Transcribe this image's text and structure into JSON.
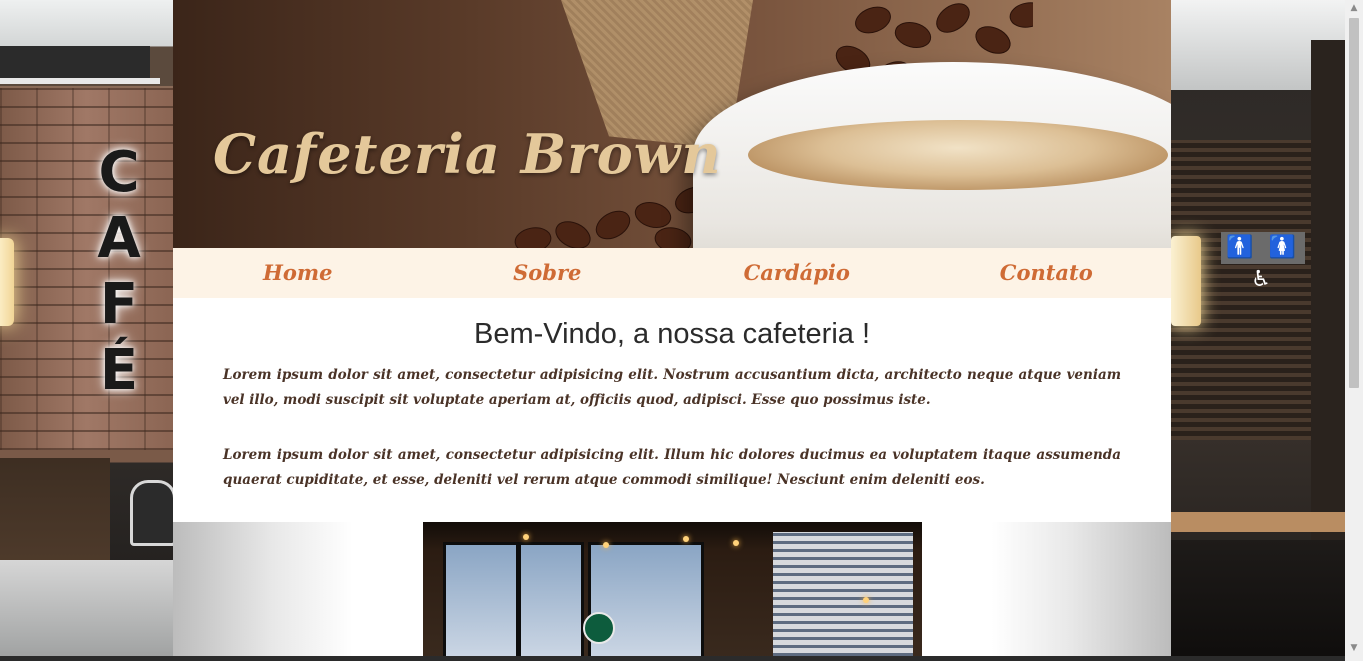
{
  "background": {
    "left_sign_letters": [
      "C",
      "A",
      "F",
      "É"
    ],
    "right_sign_icons": "🚹 🚺 ♿"
  },
  "hero": {
    "title": "Cafeteria Brown"
  },
  "nav": {
    "items": [
      {
        "label": "Home"
      },
      {
        "label": "Sobre"
      },
      {
        "label": "Cardápio"
      },
      {
        "label": "Contato"
      }
    ]
  },
  "main": {
    "heading": "Bem-Vindo, a nossa cafeteria !",
    "paragraphs": [
      "Lorem ipsum dolor sit amet, consectetur adipisicing elit. Nostrum accusantium dicta, architecto neque atque veniam vel illo, modi suscipit sit voluptate aperiam at, officiis quod, adipisci. Esse quo possimus iste.",
      "Lorem ipsum dolor sit amet, consectetur adipisicing elit. Illum hic dolores ducimus ea voluptatem itaque assumenda quaerat cupiditate, et esse, deleniti vel rerum atque commodi similique! Nesciunt enim deleniti eos."
    ]
  },
  "colors": {
    "nav_background": "#fdf3e6",
    "nav_text": "#cf6b35",
    "title_text": "#e4c89a",
    "paragraph_text": "#4a3327"
  },
  "icons": {
    "scroll_up": "▲",
    "scroll_down": "▼"
  }
}
